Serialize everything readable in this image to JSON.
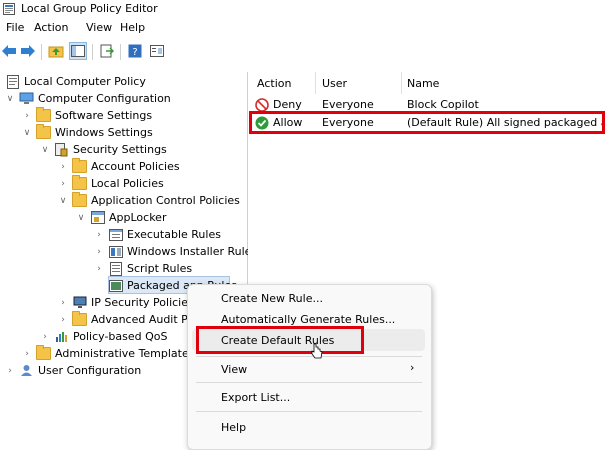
{
  "window": {
    "title": "Local Group Policy Editor"
  },
  "menubar": {
    "file": "File",
    "action": "Action",
    "view": "View",
    "help": "Help"
  },
  "tree": {
    "root": "Local Computer Policy",
    "computer_configuration": "Computer Configuration",
    "software_settings": "Software Settings",
    "windows_settings": "Windows Settings",
    "security_settings": "Security Settings",
    "account_policies": "Account Policies",
    "local_policies": "Local Policies",
    "application_control_policies": "Application Control Policies",
    "applocker": "AppLocker",
    "executable_rules": "Executable Rules",
    "windows_installer_rules": "Windows Installer Rules",
    "script_rules": "Script Rules",
    "packaged_app_rules": "Packaged app Rules",
    "ip_security_policies": "IP Security Policies",
    "advanced_audit_policy": "Advanced Audit Po",
    "policy_based_qos": "Policy-based QoS",
    "administrative_templates": "Administrative Templates",
    "user_configuration": "User Configuration"
  },
  "list": {
    "columns": {
      "action": "Action",
      "user": "User",
      "name": "Name"
    },
    "rows": [
      {
        "action": "Deny",
        "user": "Everyone",
        "name": "Block Copilot",
        "status_color": "#d0312d"
      },
      {
        "action": "Allow",
        "user": "Everyone",
        "name": "(Default Rule) All signed packaged apps",
        "status_color": "#2e9a3a"
      }
    ]
  },
  "context_menu": {
    "create_new_rule": "Create New Rule...",
    "auto_generate": "Automatically Generate Rules...",
    "create_default": "Create Default Rules",
    "view": "View",
    "export_list": "Export List...",
    "help": "Help"
  },
  "colors": {
    "highlight_red": "#e0000c",
    "folder": "#f3c448"
  }
}
